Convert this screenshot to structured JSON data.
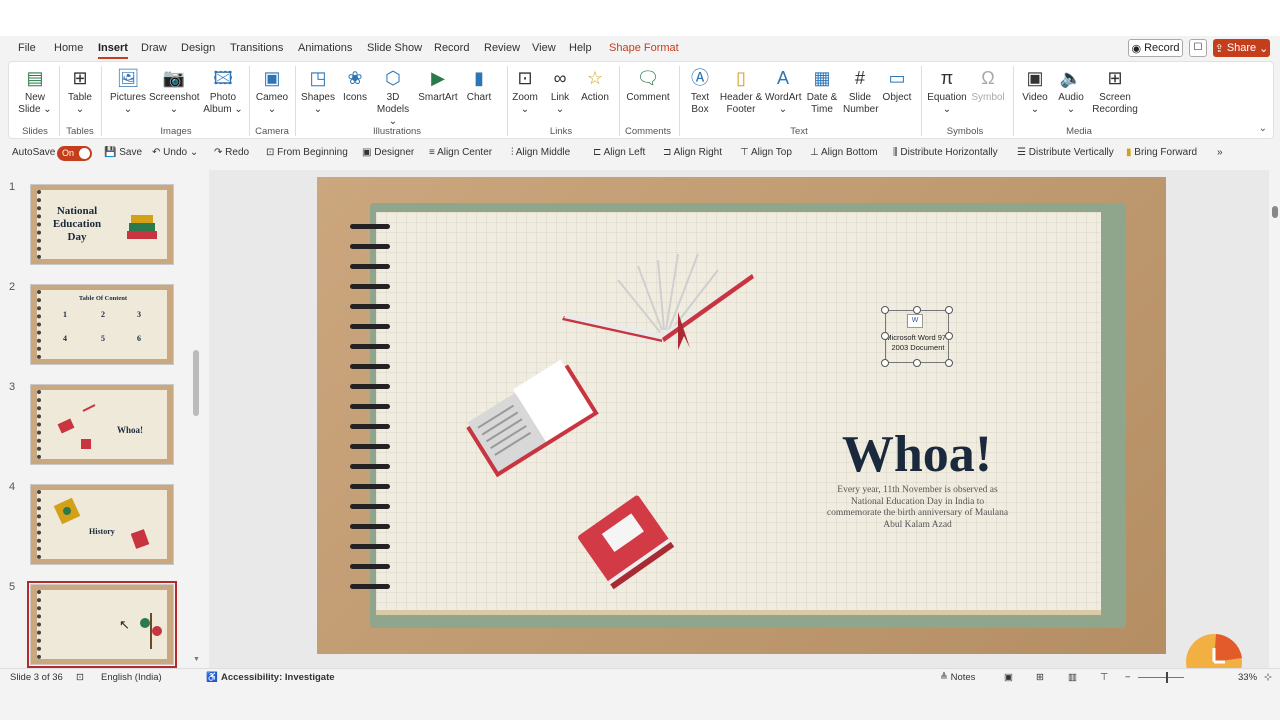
{
  "tabs": [
    "File",
    "Home",
    "Insert",
    "Draw",
    "Design",
    "Transitions",
    "Animations",
    "Slide Show",
    "Record",
    "Review",
    "View",
    "Help",
    "Shape Format"
  ],
  "header": {
    "record_label": "Record",
    "share_label": "Share"
  },
  "ribbon": {
    "buttons": [
      "New Slide",
      "Table",
      "Pictures",
      "Screenshot",
      "Photo Album",
      "Cameo",
      "Shapes",
      "Icons",
      "3D Models",
      "SmartArt",
      "Chart",
      "Zoom",
      "Link",
      "Action",
      "Comment",
      "Text Box",
      "Header & Footer",
      "WordArt",
      "Date & Time",
      "Slide Number",
      "Object",
      "Equation",
      "Symbol",
      "Video",
      "Audio",
      "Screen Recording"
    ],
    "groups": [
      "Slides",
      "Tables",
      "Images",
      "Camera",
      "Illustrations",
      "Links",
      "Comments",
      "Text",
      "Symbols",
      "Media"
    ]
  },
  "qat": {
    "autosave": "AutoSave",
    "toggle": "On",
    "save": "Save",
    "undo": "Undo",
    "redo": "Redo",
    "items": [
      "From Beginning",
      "Designer",
      "Align Center",
      "Align Middle",
      "Align Left",
      "Align Right",
      "Align Top",
      "Align Bottom",
      "Distribute Horizontally",
      "Distribute Vertically",
      "Bring Forward"
    ]
  },
  "thumbs": {
    "numbers": [
      "1",
      "2",
      "3",
      "4",
      "5"
    ],
    "t1": "National Education Day",
    "t2": "Table Of Content",
    "t3": "Whoa!",
    "t4": "History",
    "toc_nums": [
      "1",
      "2",
      "3",
      "4",
      "5",
      "6"
    ]
  },
  "slide": {
    "title": "Whoa!",
    "description": "Every year, 11th November is observed as National Education Day in India to commemorate the birth anniversary of Maulana Abul Kalam Azad",
    "ole_label": "Microsoft Word 97 - 2003 Document",
    "ole_icon": "W"
  },
  "status": {
    "slide": "Slide 3 of 36",
    "language": "English (India)",
    "accessibility": "Accessibility: Investigate",
    "notes": "Notes",
    "zoom": "33%"
  },
  "colors": {
    "accent": "#c43e1c",
    "book_red": "#c8343f",
    "title_navy": "#1a2a3c"
  }
}
